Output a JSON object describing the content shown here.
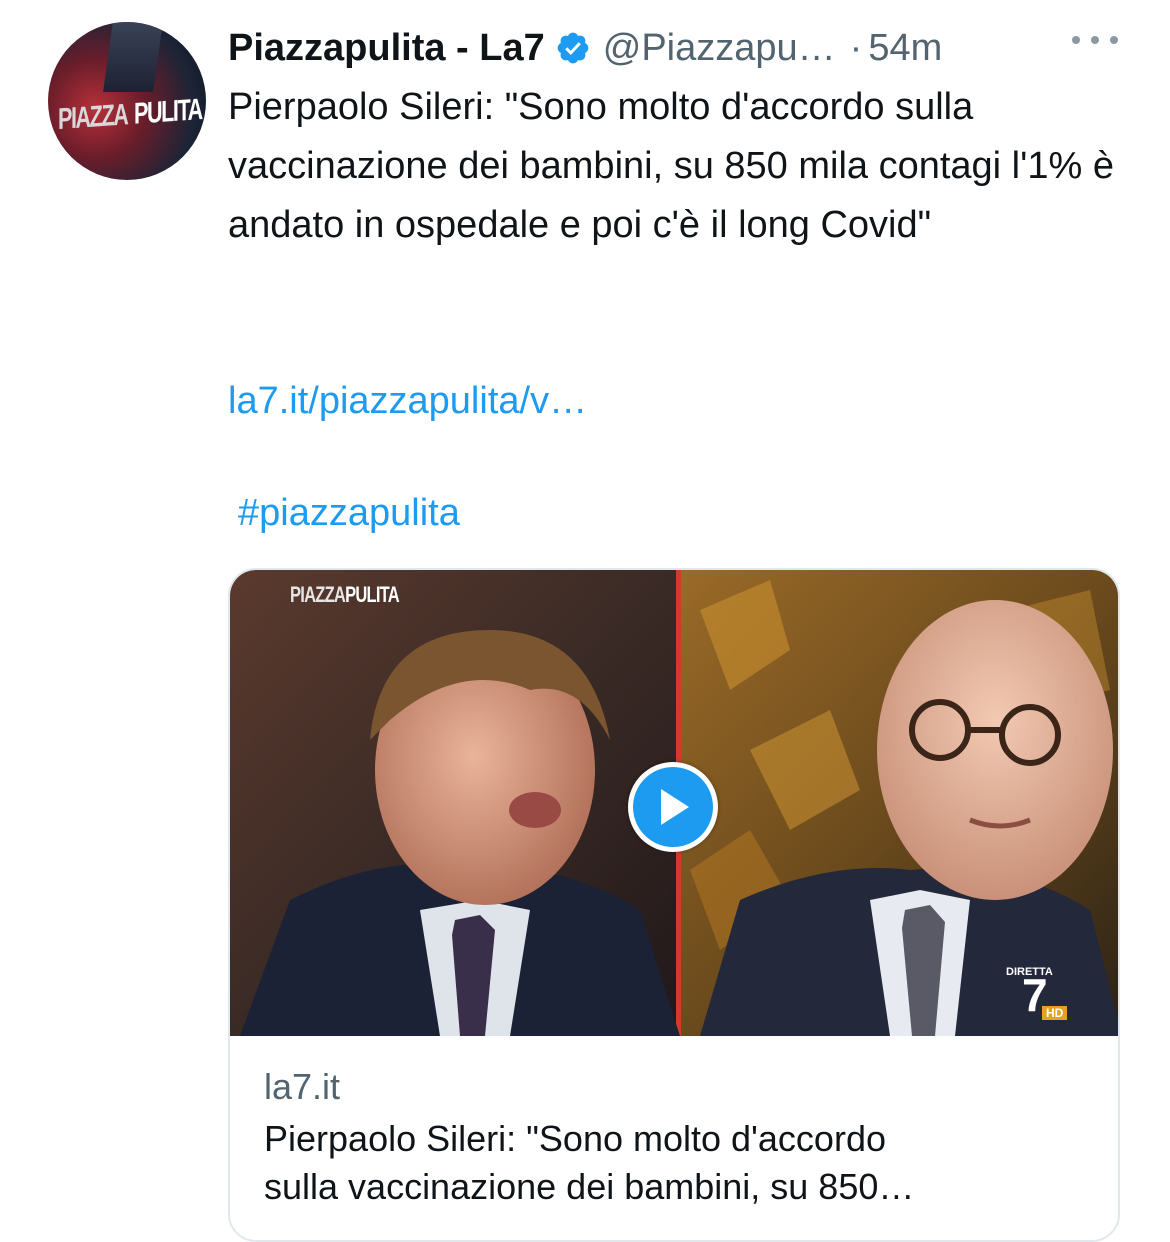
{
  "tweet": {
    "author_name": "Piazzapulita - La7",
    "handle": "@Piazzapu…",
    "dot": "·",
    "time": "54m",
    "avatar_text_a": "PIAZZA",
    "avatar_text_b": "PULITA",
    "text": "Pierpaolo Sileri: \"Sono molto d'accordo sulla vaccinazione dei bambini, su 850 mila contagi l'1% è andato in ospedale e poi c'è il long Covid\"",
    "link": "la7.it/piazzapulita/v…",
    "hashtag": "#piazzapulita"
  },
  "card": {
    "watermark_a": "PIAZZA",
    "watermark_b": "PULITA",
    "channel_small": "DIRETTA",
    "channel_logo": "7",
    "channel_hd": "HD",
    "domain": "la7.it",
    "title_line1": "Pierpaolo Sileri: \"Sono molto d'accordo",
    "title_line2": "sulla vaccinazione dei bambini, su 850…"
  },
  "colors": {
    "link": "#1d9bf0",
    "secondary_text": "#536471",
    "verified_badge": "#1d9bf0"
  },
  "icons": {
    "verified": "verified-badge-icon",
    "more": "more-options-icon",
    "play": "play-icon"
  }
}
